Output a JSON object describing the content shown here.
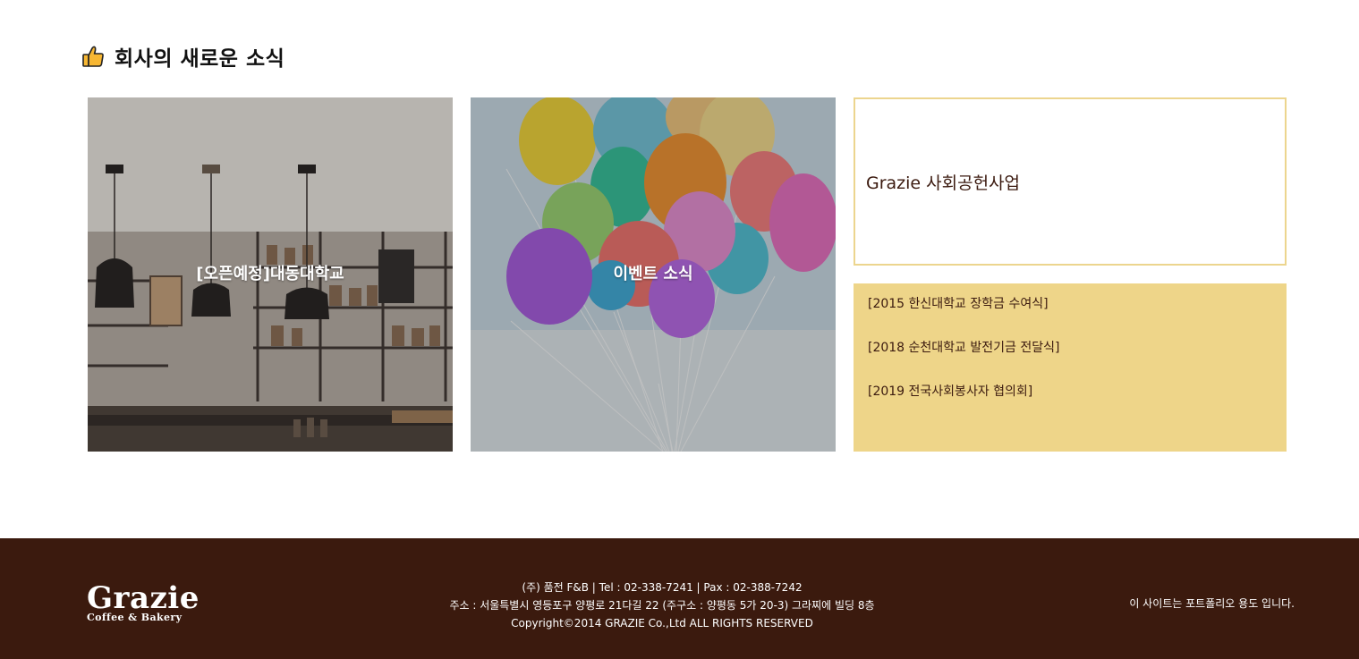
{
  "section": {
    "title": "회사의 새로운 소식",
    "icon": "thumbs-up-icon"
  },
  "cards": [
    {
      "label": "[오픈예정]대동대학교",
      "image": "cafe-interior-image"
    },
    {
      "label": "이벤트 소식",
      "image": "balloons-image"
    }
  ],
  "promo": {
    "title": "Grazie 사회공헌사업"
  },
  "news": {
    "items": [
      "[2015 한신대학교 장학금 수여식]",
      "[2018 순천대학교 발전기금 전달식]",
      "[2019 전국사회봉사자 협의회]"
    ]
  },
  "footer": {
    "logo_main": "Grazie",
    "logo_sub": "Coffee & Bakery",
    "info_line1": "(주) 품전 F&B | Tel : 02-338-7241 | Pax : 02-388-7242",
    "info_line2": "주소 : 서울특별시 영등포구 양평로 21다길 22 (주구소 : 양평동 5가 20-3) 그라찌에 빌딩 8층",
    "info_line3": "Copyright©2014 GRAZIE Co.,Ltd ALL RIGHTS RESERVED",
    "note": "이 사이트는 포트폴리오 용도 입니다."
  },
  "colors": {
    "accent": "#eed589",
    "footer_bg": "#3b1a0e",
    "text_brown": "#3b1a0f"
  }
}
